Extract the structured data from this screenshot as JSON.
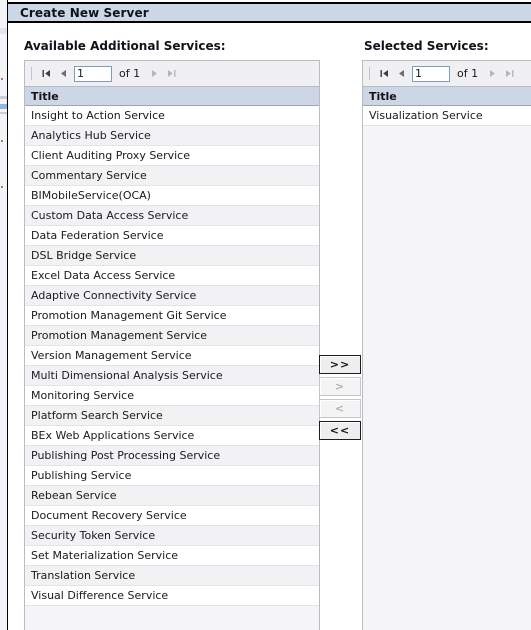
{
  "dialog": {
    "title": "Create New Server"
  },
  "available": {
    "label": "Available Additional Services:",
    "pager": {
      "first_icon": "first-page-icon",
      "prev_icon": "previous-page-icon",
      "page_value": "1",
      "page_placeholder": "",
      "of_text": "of 1",
      "next_icon": "next-page-icon",
      "last_icon": "last-page-icon"
    },
    "column_header": "Title",
    "rows": [
      "Insight to Action Service",
      "Analytics Hub Service",
      "Client Auditing Proxy Service",
      "Commentary Service",
      "BIMobileService(OCA)",
      "Custom Data Access Service",
      "Data Federation Service",
      "DSL Bridge Service",
      "Excel Data Access Service",
      "Adaptive Connectivity Service",
      "Promotion Management Git Service",
      "Promotion Management Service",
      "Version Management Service",
      "Multi Dimensional Analysis Service",
      "Monitoring Service",
      "Platform Search Service",
      "BEx Web Applications Service",
      "Publishing Post Processing Service",
      "Publishing Service",
      "Rebean Service",
      "Document Recovery Service",
      "Security Token Service",
      "Set Materialization Service",
      "Translation Service",
      "Visual Difference Service"
    ]
  },
  "selected": {
    "label": "Selected Services:",
    "pager": {
      "first_icon": "first-page-icon",
      "prev_icon": "previous-page-icon",
      "page_value": "1",
      "page_placeholder": "",
      "of_text": "of 1",
      "next_icon": "next-page-icon",
      "last_icon": "last-page-icon"
    },
    "column_header": "Title",
    "rows": [
      "Visualization Service"
    ]
  },
  "transfer_buttons": [
    {
      "label": ">>",
      "name": "add-all-button",
      "state": "enabled"
    },
    {
      "label": ">",
      "name": "add-selected-button",
      "state": "disabled"
    },
    {
      "label": "<",
      "name": "remove-selected-button",
      "state": "disabled"
    },
    {
      "label": "<<",
      "name": "remove-all-button",
      "state": "enabled"
    }
  ],
  "colors": {
    "titlebar": "#ccd8e8",
    "grid_header": "#ccd6e4",
    "panel_background": "#f5f5f8",
    "row_alt": "#f2f2f4",
    "input_border": "#7f9db9"
  }
}
